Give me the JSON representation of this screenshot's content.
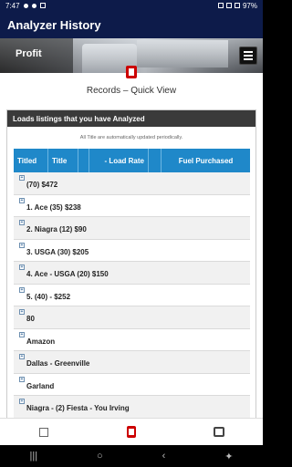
{
  "status_bar": {
    "time": "7:47",
    "battery": "97%"
  },
  "app_bar": {
    "title": "Analyzer History"
  },
  "hero": {
    "label": "Profit"
  },
  "page": {
    "records_title": "Records – Quick View"
  },
  "panel": {
    "header": "Loads listings that you have Analyzed",
    "note": "All Title are automatically updated periodically."
  },
  "table": {
    "columns": [
      "Titled",
      "Title",
      "",
      "- Load Rate",
      "",
      "Fuel Purchased"
    ],
    "rows": [
      "(70) $472",
      "1. Ace (35) $238",
      "2. Niagra (12) $90",
      "3. USGA (30) $205",
      "4. Ace - USGA (20) $150",
      "5. (40) - $252",
      "80",
      "Amazon",
      "Dallas - Greenville",
      "Garland",
      "Niagra - (2) Fiesta - You Irving"
    ]
  },
  "bottom_nav": {
    "items": [
      "calculator-icon",
      "clipboard-icon",
      "bus-icon"
    ]
  },
  "system_nav": {
    "items": [
      "recents-icon",
      "home-icon",
      "back-icon",
      "accessibility-icon"
    ]
  }
}
